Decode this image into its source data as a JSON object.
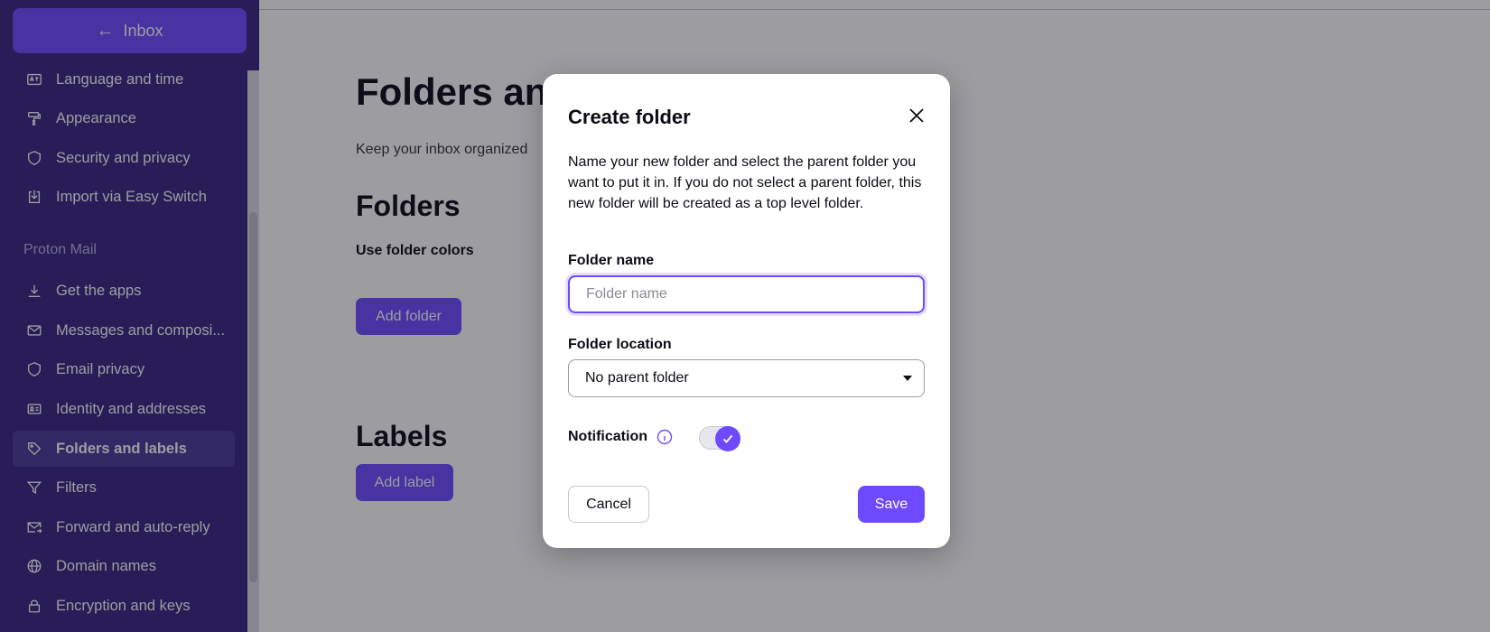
{
  "sidebar": {
    "inbox_button": {
      "arrow": "←",
      "label": "Inbox"
    },
    "items_top": [
      {
        "label": "Language and time",
        "icon": "language-icon"
      },
      {
        "label": "Appearance",
        "icon": "paint-roller-icon"
      },
      {
        "label": "Security and privacy",
        "icon": "shield-icon"
      },
      {
        "label": "Import via Easy Switch",
        "icon": "import-icon"
      }
    ],
    "section_label": "Proton Mail",
    "items_mail": [
      {
        "label": "Get the apps",
        "icon": "download-icon"
      },
      {
        "label": "Messages and composi...",
        "icon": "envelope-icon"
      },
      {
        "label": "Email privacy",
        "icon": "shield-icon"
      },
      {
        "label": "Identity and addresses",
        "icon": "id-card-icon"
      },
      {
        "label": "Folders and labels",
        "icon": "tag-icon",
        "active": true
      },
      {
        "label": "Filters",
        "icon": "filter-icon"
      },
      {
        "label": "Forward and auto-reply",
        "icon": "forward-mail-icon"
      },
      {
        "label": "Domain names",
        "icon": "globe-icon"
      },
      {
        "label": "Encryption and keys",
        "icon": "lock-icon"
      }
    ]
  },
  "main": {
    "title": "Folders and",
    "description": "Keep your inbox organized",
    "folders_heading": "Folders",
    "use_folder_colors": "Use folder colors",
    "add_folder": "Add folder",
    "labels_heading": "Labels",
    "add_label": "Add label"
  },
  "modal": {
    "title": "Create folder",
    "description": "Name your new folder and select the parent folder you want to put it in. If you do not select a parent folder, this new folder will be created as a top level folder.",
    "folder_name_label": "Folder name",
    "folder_name_placeholder": "Folder name",
    "folder_name_value": "",
    "folder_location_label": "Folder location",
    "folder_location_value": "No parent folder",
    "notification_label": "Notification",
    "notification_enabled": true,
    "cancel": "Cancel",
    "save": "Save"
  },
  "colors": {
    "accent": "#6d4aff",
    "sidebar_bg": "#372580"
  }
}
